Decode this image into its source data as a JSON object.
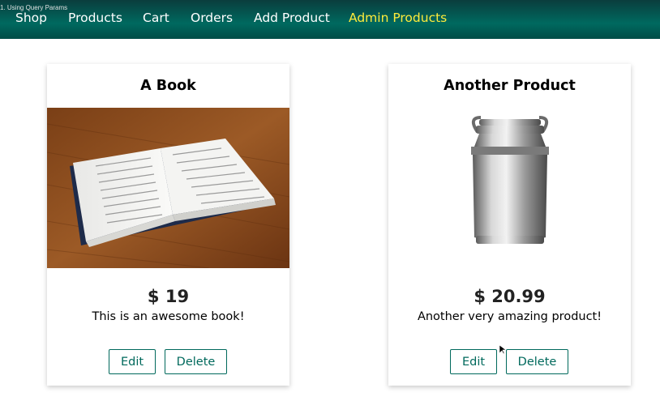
{
  "video_title": "1. Using Query Params",
  "nav": [
    {
      "label": "Shop"
    },
    {
      "label": "Products"
    },
    {
      "label": "Cart"
    },
    {
      "label": "Orders"
    },
    {
      "label": "Add Product"
    },
    {
      "label": "Admin Products",
      "active": true
    }
  ],
  "products": [
    {
      "title": "A Book",
      "price": "$ 19",
      "description": "This is an awesome book!",
      "image": "open-book-photo",
      "edit_label": "Edit",
      "delete_label": "Delete"
    },
    {
      "title": "Another Product",
      "price": "$ 20.99",
      "description": "Another very amazing product!",
      "image": "metal-milk-can-photo",
      "edit_label": "Edit",
      "delete_label": "Delete"
    }
  ],
  "colors": {
    "header": "#00695f",
    "active_nav": "#ffeb3b",
    "button_border": "#00695c"
  }
}
